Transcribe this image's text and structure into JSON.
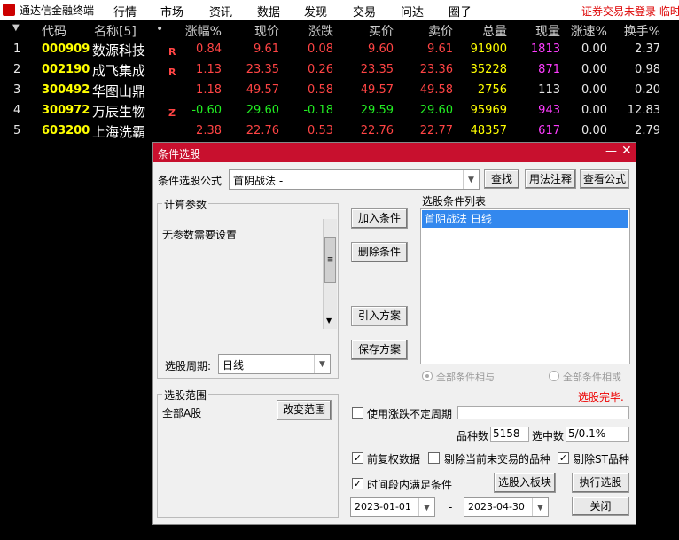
{
  "menubar": {
    "app_title": "通达信金融终端",
    "items": [
      "行情",
      "市场",
      "资讯",
      "数据",
      "发现",
      "交易",
      "问达",
      "圈子"
    ],
    "login_status": "证券交易未登录  临时"
  },
  "table": {
    "columns": [
      "代码",
      "名称[5]",
      "•",
      "涨幅%",
      "现价",
      "涨跌",
      "买价",
      "卖价",
      "总量",
      "现量",
      "涨速%",
      "换手%"
    ],
    "rows": [
      {
        "idx": "1",
        "code": "000909",
        "name": "数源科技",
        "flag": "R",
        "pct": "0.84",
        "price": "9.61",
        "chg": "0.08",
        "bid": "9.60",
        "ask": "9.61",
        "vol": "91900",
        "cur": "1813",
        "speed": "0.00",
        "turn": "2.37",
        "dir": "up"
      },
      {
        "idx": "2",
        "code": "002190",
        "name": "成飞集成",
        "flag": "R",
        "pct": "1.13",
        "price": "23.35",
        "chg": "0.26",
        "bid": "23.35",
        "ask": "23.36",
        "vol": "35228",
        "cur": "871",
        "speed": "0.00",
        "turn": "0.98",
        "dir": "up"
      },
      {
        "idx": "3",
        "code": "300492",
        "name": "华图山鼎",
        "flag": "",
        "pct": "1.18",
        "price": "49.57",
        "chg": "0.58",
        "bid": "49.57",
        "ask": "49.58",
        "vol": "2756",
        "cur": "113",
        "speed": "0.00",
        "turn": "0.20",
        "dir": "up"
      },
      {
        "idx": "4",
        "code": "300972",
        "name": "万辰生物",
        "flag": "Z",
        "pct": "-0.60",
        "price": "29.60",
        "chg": "-0.18",
        "bid": "29.59",
        "ask": "29.60",
        "vol": "95969",
        "cur": "943",
        "speed": "0.00",
        "turn": "12.83",
        "dir": "down"
      },
      {
        "idx": "5",
        "code": "603200",
        "name": "上海洗霸",
        "flag": "",
        "pct": "2.38",
        "price": "22.76",
        "chg": "0.53",
        "bid": "22.76",
        "ask": "22.77",
        "vol": "48357",
        "cur": "617",
        "speed": "0.00",
        "turn": "2.79",
        "dir": "up"
      }
    ]
  },
  "dialog": {
    "title": "条件选股",
    "minimize": "—",
    "close": "✕",
    "formula_label": "条件选股公式",
    "formula_value": "首阴战法      -",
    "find_button": "查找",
    "usage_button": "用法注释",
    "view_formula_button": "查看公式",
    "params_group": "计算参数",
    "params_text": "无参数需要设置",
    "period_label": "选股周期:",
    "period_value": "日线",
    "add_button": "加入条件",
    "delete_button": "删除条件",
    "import_button": "引入方案",
    "save_button": "保存方案",
    "cond_list_label": "选股条件列表",
    "cond_items": [
      "首阴战法  日线"
    ],
    "radio_and": "全部条件相与",
    "radio_or": "全部条件相或",
    "status": "选股完毕.",
    "scope_group": "选股范围",
    "scope_value": "全部A股",
    "change_scope_button": "改变范围",
    "unfixed_period_label": "使用涨跌不定周期",
    "count_label": "品种数",
    "count_value": "5158",
    "selected_label": "选中数",
    "selected_value": "5/0.1%",
    "pre_adjust_label": "前复权数据",
    "remove_untraded_label": "剔除当前未交易的品种",
    "remove_st_label": "剔除ST品种",
    "period_satisfy_label": "时间段内满足条件",
    "to_block_button": "选股入板块",
    "execute_button": "执行选股",
    "date_from": "2023-01-01",
    "date_sep": "-",
    "date_to": "2023-04-30",
    "close_button": "关闭"
  },
  "colors": {
    "up": "#ff4444",
    "down": "#22ee22",
    "code": "#ffff00",
    "title_bar": "#c8102e",
    "selection": "#3388ee"
  }
}
